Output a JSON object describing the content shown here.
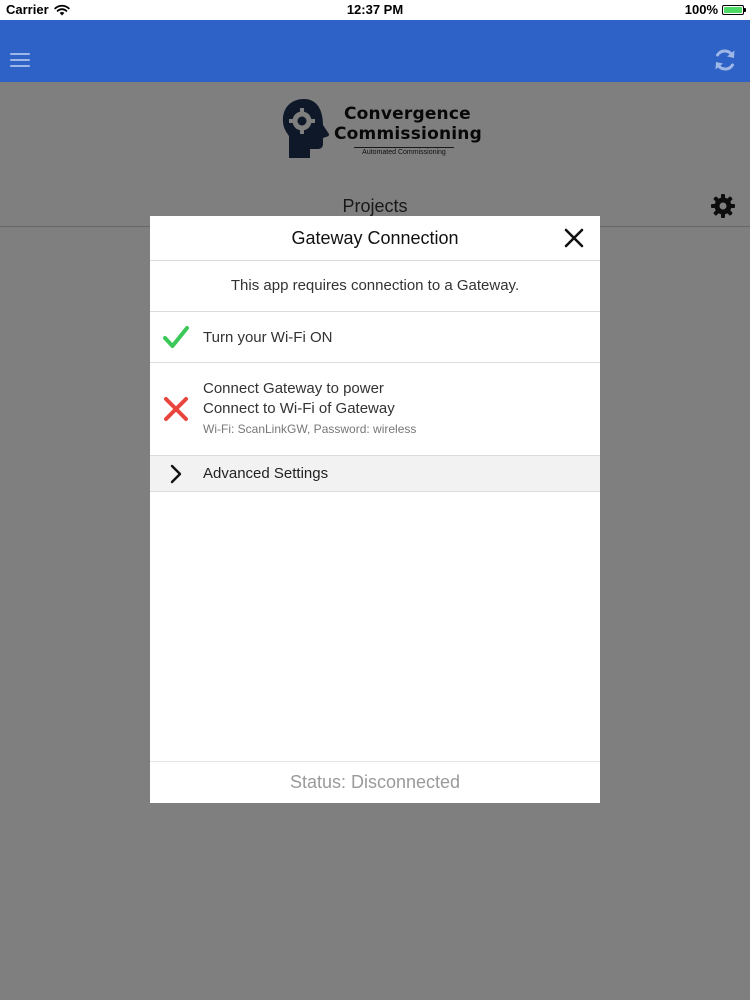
{
  "status_bar": {
    "carrier": "Carrier",
    "time": "12:37 PM",
    "battery": "100%",
    "battery_level": 1.0
  },
  "navbar": {
    "color": "#2e62c6",
    "left_icon": "menu-icon",
    "right_icon": "refresh-icon"
  },
  "logo": {
    "line1": "Convergence",
    "line2": "Commissioning",
    "tagline": "Automated Commissioning"
  },
  "page": {
    "title": "Projects",
    "settings_icon": "gear-icon"
  },
  "modal": {
    "title": "Gateway Connection",
    "intro": "This app requires connection to a Gateway.",
    "wifi_step": {
      "label": "Turn your Wi-Fi ON",
      "state": "done",
      "icon": "check-icon",
      "color": "#3cc95a"
    },
    "gateway_step": {
      "line1": "Connect Gateway to power",
      "line2": "Connect to Wi-Fi of Gateway",
      "hint": "Wi-Fi: ScanLinkGW, Password: wireless",
      "state": "failed",
      "icon": "x-icon",
      "color": "#e8453c"
    },
    "advanced": {
      "label": "Advanced Settings"
    },
    "status": "Status: Disconnected"
  }
}
